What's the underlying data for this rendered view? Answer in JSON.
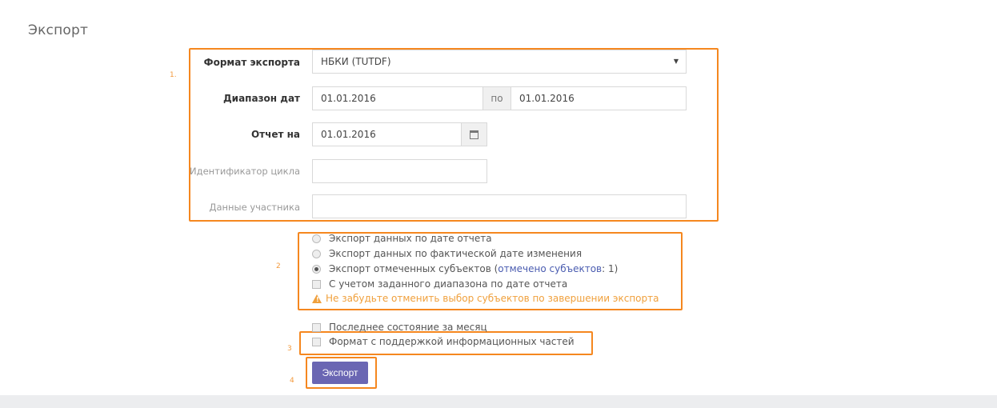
{
  "page": {
    "title": "Экспорт"
  },
  "callouts": {
    "n1": "1.",
    "n2": "2",
    "n3": "3",
    "n4": "4"
  },
  "form": {
    "format_label": "Формат экспорта",
    "format_value": "НБКИ (TUTDF)",
    "date_range_label": "Диапазон дат",
    "date_from": "01.01.2016",
    "date_to_sep": "по",
    "date_to": "01.01.2016",
    "report_on_label": "Отчет на",
    "report_on_value": "01.01.2016",
    "cycle_id_label": "Идентификатор цикла",
    "cycle_id_value": "",
    "participant_label": "Данные участника",
    "participant_value": ""
  },
  "options": {
    "radio1": "Экспорт данных по дате отчета",
    "radio2": "Экспорт данных по фактической дате изменения",
    "radio3_prefix": "Экспорт отмеченных субъектов (",
    "radio3_link": "отмечено субъектов",
    "radio3_suffix": ": 1)",
    "check1": "С учетом заданного диапазона по дате отчета",
    "warning": "Не забудьте отменить выбор субъектов по завершении экспорта",
    "check2": "Последнее состояние за месяц",
    "check3": "Формат с поддержкой информационных частей",
    "selected_radio": "radio3"
  },
  "actions": {
    "export_button": "Экспорт"
  },
  "colors": {
    "highlight": "#f5871f",
    "button": "#6a66b3",
    "link": "#4a5cb0",
    "warning": "#f0a03c"
  }
}
